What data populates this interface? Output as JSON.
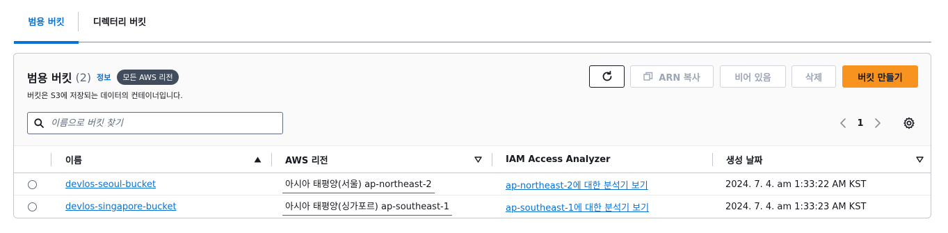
{
  "tabs": [
    {
      "label": "범용 버킷",
      "active": true
    },
    {
      "label": "디렉터리 버킷",
      "active": false
    }
  ],
  "header": {
    "title": "범용 버킷",
    "count": "(2)",
    "info_link": "정보",
    "region_badge": "모든 AWS 리전",
    "description": "버킷은 S3에 저장되는 데이터의 컨테이너입니다."
  },
  "toolbar": {
    "refresh_icon": "refresh-icon",
    "copy_arn_label": "ARN 복사",
    "empty_label": "비어 있음",
    "delete_label": "삭제",
    "create_label": "버킷 만들기"
  },
  "search": {
    "placeholder": "이름으로 버킷 찾기",
    "value": ""
  },
  "pagination": {
    "current_page": "1"
  },
  "table": {
    "columns": [
      "이름",
      "AWS 리전",
      "IAM Access Analyzer",
      "생성 날짜"
    ],
    "rows": [
      {
        "name": "devlos-seoul-bucket",
        "region": "아시아 태평양(서울) ap-northeast-2",
        "analyzer": "ap-northeast-2에 대한 분석기 보기",
        "created": "2024. 7. 4. am 1:33:22 AM KST"
      },
      {
        "name": "devlos-singapore-bucket",
        "region": "아시아 태평양(싱가포르) ap-southeast-1",
        "analyzer": "ap-southeast-1에 대한 분석기 보기",
        "created": "2024. 7. 4. am 1:33:23 AM KST"
      }
    ]
  },
  "colors": {
    "accent": "#0972d3",
    "primary_button": "#f7931e",
    "badge": "#414d5c",
    "error_underline": "#d13212"
  }
}
